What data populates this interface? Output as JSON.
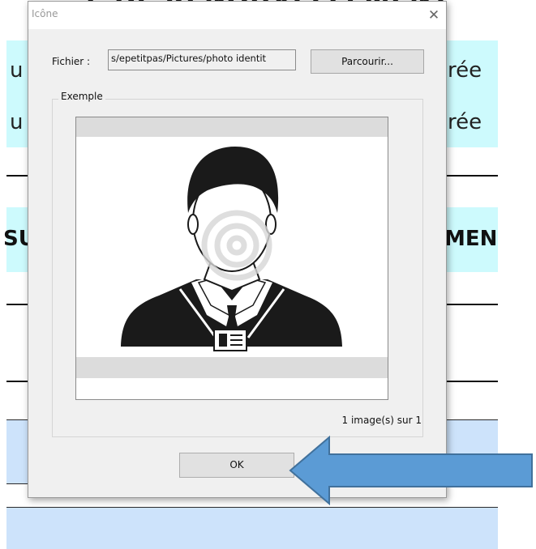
{
  "document": {
    "title_fragment": "E DE RENOUVELLEMENT",
    "row1_left": "u",
    "row1_right": "rée",
    "row2_left": "u",
    "row2_right": "rée",
    "heading_left": "SU",
    "heading_right": "MEN",
    "colors": {
      "cyan": "#cdfafd",
      "blue": "#cde3fb"
    }
  },
  "dialog": {
    "title": "Icône",
    "close_icon": "close-icon",
    "file_label": "Fichier :",
    "file_value": "s/epetitpas/Pictures/photo identit",
    "browse_label": "Parcourir...",
    "group_label": "Exemple",
    "preview_image": "person-silhouette-icon",
    "image_count": "1 image(s) sur 1",
    "ok_label": "OK"
  },
  "annotation": {
    "arrow": "blue-arrow-pointing-left",
    "color": "#5b9bd5"
  }
}
